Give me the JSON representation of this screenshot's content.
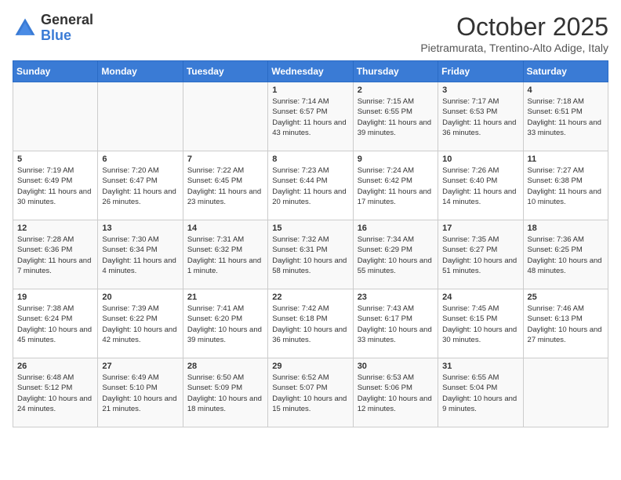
{
  "header": {
    "logo_general": "General",
    "logo_blue": "Blue",
    "month": "October 2025",
    "subtitle": "Pietramurata, Trentino-Alto Adige, Italy"
  },
  "days_of_week": [
    "Sunday",
    "Monday",
    "Tuesday",
    "Wednesday",
    "Thursday",
    "Friday",
    "Saturday"
  ],
  "weeks": [
    [
      {
        "day": "",
        "text": ""
      },
      {
        "day": "",
        "text": ""
      },
      {
        "day": "",
        "text": ""
      },
      {
        "day": "1",
        "text": "Sunrise: 7:14 AM\nSunset: 6:57 PM\nDaylight: 11 hours and 43 minutes."
      },
      {
        "day": "2",
        "text": "Sunrise: 7:15 AM\nSunset: 6:55 PM\nDaylight: 11 hours and 39 minutes."
      },
      {
        "day": "3",
        "text": "Sunrise: 7:17 AM\nSunset: 6:53 PM\nDaylight: 11 hours and 36 minutes."
      },
      {
        "day": "4",
        "text": "Sunrise: 7:18 AM\nSunset: 6:51 PM\nDaylight: 11 hours and 33 minutes."
      }
    ],
    [
      {
        "day": "5",
        "text": "Sunrise: 7:19 AM\nSunset: 6:49 PM\nDaylight: 11 hours and 30 minutes."
      },
      {
        "day": "6",
        "text": "Sunrise: 7:20 AM\nSunset: 6:47 PM\nDaylight: 11 hours and 26 minutes."
      },
      {
        "day": "7",
        "text": "Sunrise: 7:22 AM\nSunset: 6:45 PM\nDaylight: 11 hours and 23 minutes."
      },
      {
        "day": "8",
        "text": "Sunrise: 7:23 AM\nSunset: 6:44 PM\nDaylight: 11 hours and 20 minutes."
      },
      {
        "day": "9",
        "text": "Sunrise: 7:24 AM\nSunset: 6:42 PM\nDaylight: 11 hours and 17 minutes."
      },
      {
        "day": "10",
        "text": "Sunrise: 7:26 AM\nSunset: 6:40 PM\nDaylight: 11 hours and 14 minutes."
      },
      {
        "day": "11",
        "text": "Sunrise: 7:27 AM\nSunset: 6:38 PM\nDaylight: 11 hours and 10 minutes."
      }
    ],
    [
      {
        "day": "12",
        "text": "Sunrise: 7:28 AM\nSunset: 6:36 PM\nDaylight: 11 hours and 7 minutes."
      },
      {
        "day": "13",
        "text": "Sunrise: 7:30 AM\nSunset: 6:34 PM\nDaylight: 11 hours and 4 minutes."
      },
      {
        "day": "14",
        "text": "Sunrise: 7:31 AM\nSunset: 6:32 PM\nDaylight: 11 hours and 1 minute."
      },
      {
        "day": "15",
        "text": "Sunrise: 7:32 AM\nSunset: 6:31 PM\nDaylight: 10 hours and 58 minutes."
      },
      {
        "day": "16",
        "text": "Sunrise: 7:34 AM\nSunset: 6:29 PM\nDaylight: 10 hours and 55 minutes."
      },
      {
        "day": "17",
        "text": "Sunrise: 7:35 AM\nSunset: 6:27 PM\nDaylight: 10 hours and 51 minutes."
      },
      {
        "day": "18",
        "text": "Sunrise: 7:36 AM\nSunset: 6:25 PM\nDaylight: 10 hours and 48 minutes."
      }
    ],
    [
      {
        "day": "19",
        "text": "Sunrise: 7:38 AM\nSunset: 6:24 PM\nDaylight: 10 hours and 45 minutes."
      },
      {
        "day": "20",
        "text": "Sunrise: 7:39 AM\nSunset: 6:22 PM\nDaylight: 10 hours and 42 minutes."
      },
      {
        "day": "21",
        "text": "Sunrise: 7:41 AM\nSunset: 6:20 PM\nDaylight: 10 hours and 39 minutes."
      },
      {
        "day": "22",
        "text": "Sunrise: 7:42 AM\nSunset: 6:18 PM\nDaylight: 10 hours and 36 minutes."
      },
      {
        "day": "23",
        "text": "Sunrise: 7:43 AM\nSunset: 6:17 PM\nDaylight: 10 hours and 33 minutes."
      },
      {
        "day": "24",
        "text": "Sunrise: 7:45 AM\nSunset: 6:15 PM\nDaylight: 10 hours and 30 minutes."
      },
      {
        "day": "25",
        "text": "Sunrise: 7:46 AM\nSunset: 6:13 PM\nDaylight: 10 hours and 27 minutes."
      }
    ],
    [
      {
        "day": "26",
        "text": "Sunrise: 6:48 AM\nSunset: 5:12 PM\nDaylight: 10 hours and 24 minutes."
      },
      {
        "day": "27",
        "text": "Sunrise: 6:49 AM\nSunset: 5:10 PM\nDaylight: 10 hours and 21 minutes."
      },
      {
        "day": "28",
        "text": "Sunrise: 6:50 AM\nSunset: 5:09 PM\nDaylight: 10 hours and 18 minutes."
      },
      {
        "day": "29",
        "text": "Sunrise: 6:52 AM\nSunset: 5:07 PM\nDaylight: 10 hours and 15 minutes."
      },
      {
        "day": "30",
        "text": "Sunrise: 6:53 AM\nSunset: 5:06 PM\nDaylight: 10 hours and 12 minutes."
      },
      {
        "day": "31",
        "text": "Sunrise: 6:55 AM\nSunset: 5:04 PM\nDaylight: 10 hours and 9 minutes."
      },
      {
        "day": "",
        "text": ""
      }
    ]
  ]
}
